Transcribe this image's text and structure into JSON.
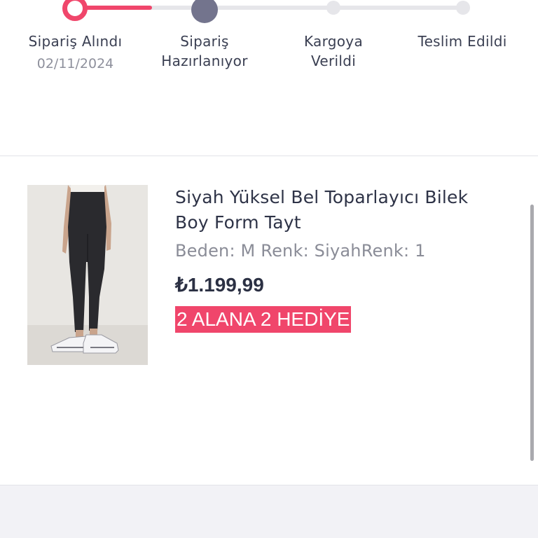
{
  "order_tracker": {
    "steps": [
      {
        "label": "Sipariş Alındı",
        "date": "02/11/2024",
        "status": "completed"
      },
      {
        "label": "Sipariş Hazırlanıyor",
        "status": "current"
      },
      {
        "label": "Kargoya Verildi",
        "status": "pending"
      },
      {
        "label": "Teslim Edildi",
        "status": "pending"
      }
    ],
    "colors": {
      "active": "#f0466b",
      "current": "#73748d",
      "inactive": "#e6e6ea"
    }
  },
  "product": {
    "title": "Siyah Yüksel Bel Toparlayıcı Bilek Boy Form Tayt",
    "attributes": "Beden: M Renk: SiyahRenk: 1",
    "price": "₺1.199,99",
    "promo": "2 ALANA 2 HEDİYE",
    "promo_color": "#f0466b",
    "image": "product-photo-black-leggings"
  }
}
